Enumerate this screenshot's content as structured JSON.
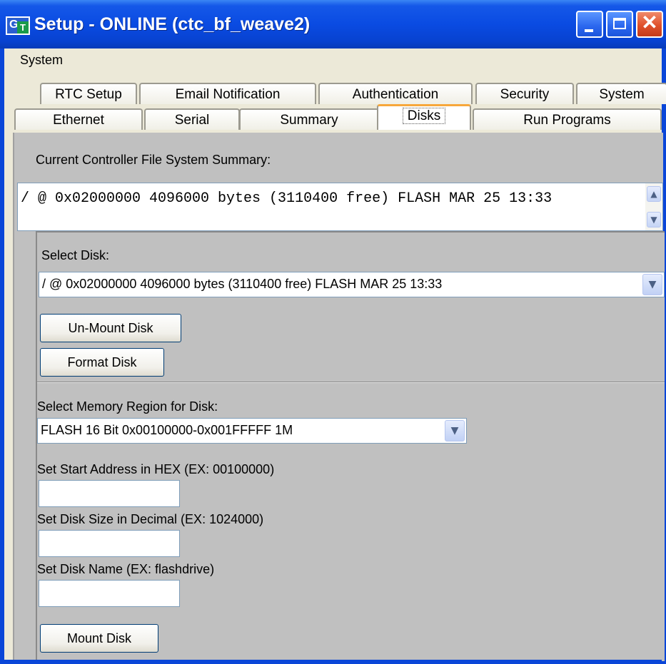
{
  "window": {
    "title": "Setup - ONLINE (ctc_bf_weave2)",
    "logo_letters": "GT",
    "minimize_label": "Minimize",
    "maximize_label": "Maximize",
    "close_label": "Close"
  },
  "menu": {
    "items": [
      "System"
    ]
  },
  "tabs": {
    "row_back": [
      "RTC Setup",
      "Email Notification",
      "Authentication",
      "Security",
      "System"
    ],
    "row_front": [
      "Ethernet",
      "Serial",
      "Summary",
      "Disks",
      "Run Programs"
    ],
    "active": "Disks"
  },
  "summary": {
    "label": "Current Controller File System Summary:",
    "text": "/ @ 0x02000000 4096000 bytes (3110400 free) FLASH MAR 25 13:33"
  },
  "disk": {
    "select_label": "Select Disk:",
    "selected": "/ @ 0x02000000 4096000 bytes (3110400 free) FLASH MAR 25 13:33",
    "unmount_label": "Un-Mount Disk",
    "format_label": "Format Disk"
  },
  "region": {
    "select_label": "Select Memory Region for Disk:",
    "selected": "FLASH 16 Bit 0x00100000-0x001FFFFF 1M",
    "start_label": "Set Start Address in HEX (EX: 00100000)",
    "start_value": "",
    "size_label": "Set Disk Size in Decimal (EX: 1024000)",
    "size_value": "",
    "name_label": "Set Disk Name (EX: flashdrive)",
    "name_value": "",
    "mount_label": "Mount Disk"
  }
}
